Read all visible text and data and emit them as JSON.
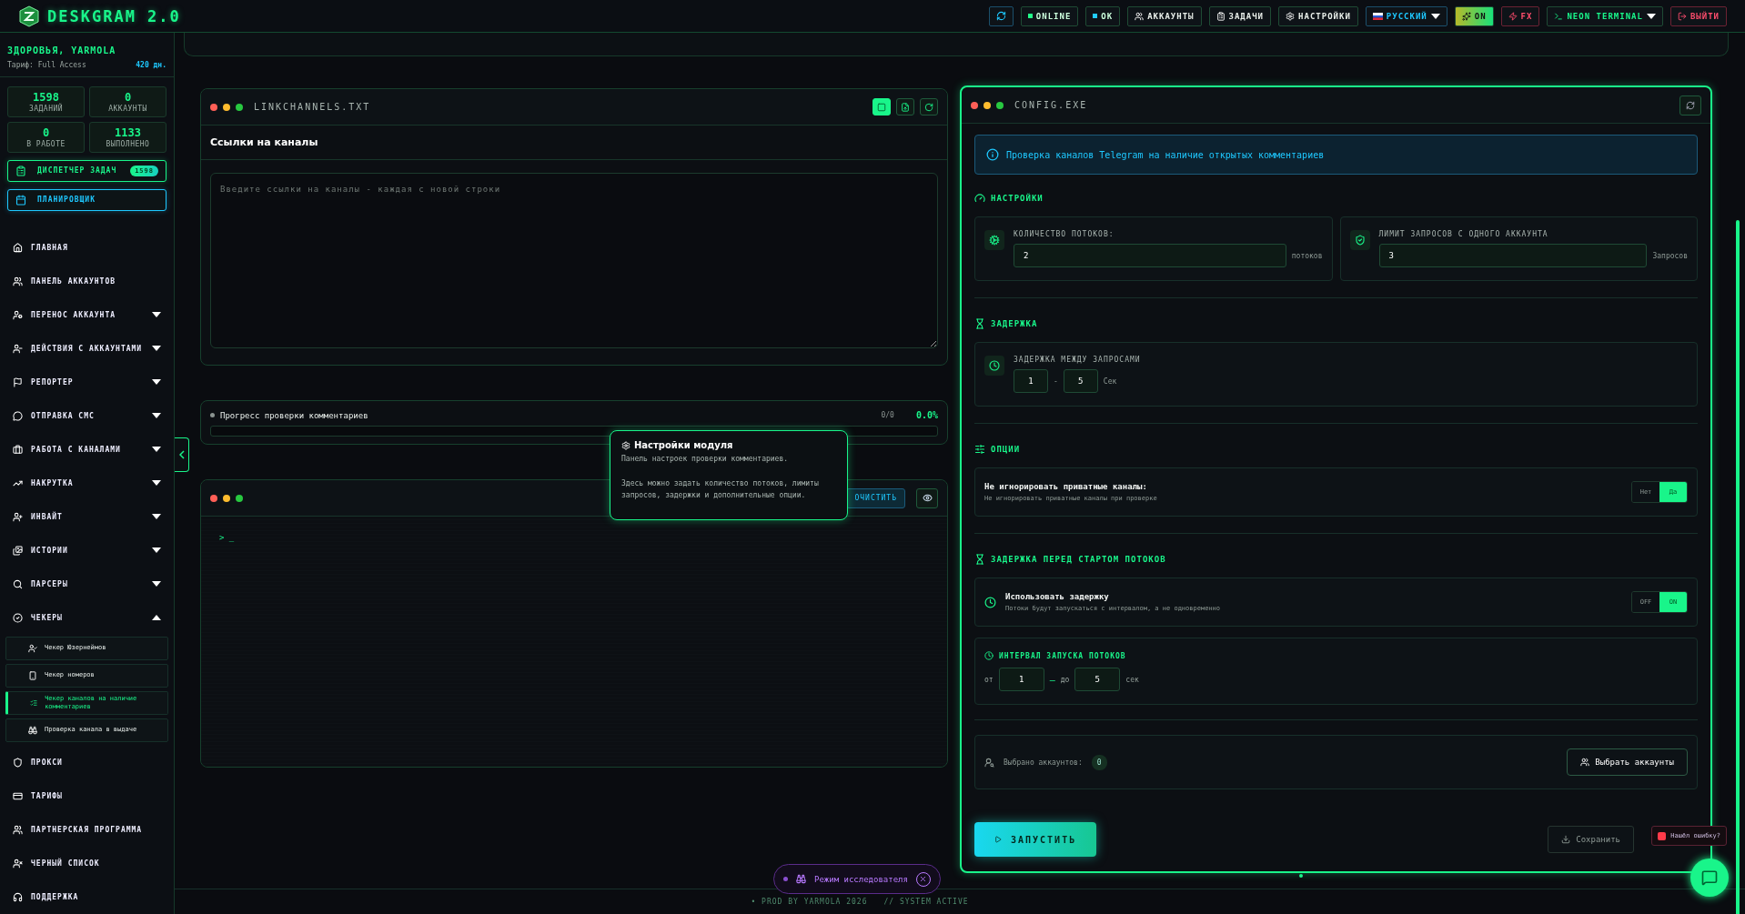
{
  "app": {
    "title": "DESKGRAM 2.0"
  },
  "header_buttons": [
    {
      "kind": "refresh"
    },
    {
      "kind": "status",
      "label": "ONLINE",
      "color": "#22ff88"
    },
    {
      "kind": "status",
      "label": "OK",
      "color": "#22ccff"
    },
    {
      "kind": "nav",
      "label": "АККАУНТЫ"
    },
    {
      "kind": "nav",
      "label": "ЗАДАЧИ"
    },
    {
      "kind": "nav",
      "label": "НАСТРОЙКИ"
    },
    {
      "kind": "language",
      "label": "РУССКИЙ"
    },
    {
      "kind": "toggle",
      "label": "ON",
      "on": true
    },
    {
      "kind": "fx",
      "label": "FX"
    },
    {
      "kind": "theme",
      "label": "NEON TERMINAL"
    },
    {
      "kind": "logout",
      "label": "ВЫЙТИ"
    }
  ],
  "sidebar": {
    "greeting": "ЗДОРОВЬЯ, YARMOLA",
    "tariff": "Тариф: Full Access",
    "days": "420 дн.",
    "stats": [
      {
        "value": "1598",
        "label": "ЗАДАНИЙ"
      },
      {
        "value": "0",
        "label": "АККАУНТЫ"
      },
      {
        "value": "0",
        "label": "В РАБОТЕ"
      },
      {
        "value": "1133",
        "label": "ВЫПОЛНЕНО"
      }
    ],
    "task_manager": {
      "label": "ДИСПЕТЧЕР ЗАДАЧ",
      "count": "1598"
    },
    "scheduler": {
      "label": "ПЛАНИРОВЩИК"
    },
    "items": [
      {
        "label": "ГЛАВНАЯ"
      },
      {
        "label": "ПАНЕЛЬ АККАУНТОВ"
      },
      {
        "label": "ПЕРЕНОС АККАУНТА",
        "expanded": false
      },
      {
        "label": "ДЕЙСТВИЯ С АККАУНТАМИ",
        "expanded": false
      },
      {
        "label": "РЕПОРТЕР",
        "expanded": false
      },
      {
        "label": "ОТПРАВКА СМС",
        "expanded": false
      },
      {
        "label": "РАБОТА С КАНАЛАМИ",
        "expanded": false
      },
      {
        "label": "НАКРУТКА",
        "expanded": false
      },
      {
        "label": "ИНВАЙТ",
        "expanded": false
      },
      {
        "label": "ИСТОРИИ",
        "expanded": false
      },
      {
        "label": "ПАРСЕРЫ",
        "expanded": false
      },
      {
        "label": "ЧЕКЕРЫ",
        "expanded": true,
        "children": [
          {
            "label": "Чекер Юзернеймов",
            "selected": false
          },
          {
            "label": "Чекер номеров",
            "selected": false
          },
          {
            "label": "Чекер каналов на наличие комментариев",
            "selected": true
          },
          {
            "label": "Проверка канала в выдаче",
            "selected": false
          }
        ]
      },
      {
        "label": "ПРОКСИ"
      },
      {
        "label": "ТАРИФЫ"
      },
      {
        "label": "ПАРТНЕРСКАЯ ПРОГРАММА"
      },
      {
        "label": "ЧЕРНЫЙ СПИСОК"
      },
      {
        "label": "ПОДДЕРЖКА"
      }
    ]
  },
  "file_panel": {
    "title": "LINKCHANNELS.TXT",
    "tools": [
      {
        "selected": true
      },
      {
        "selected": false
      },
      {
        "selected": false
      }
    ],
    "heading": "Ссылки на каналы",
    "placeholder": "Введите ссылки на каналы - каждая с новой строки"
  },
  "progress": {
    "label": "Прогресс проверки комментариев",
    "count": "0/0",
    "percent": "0.0%",
    "level": 0
  },
  "terminal": {
    "clear_label": "ОЧИСТИТЬ",
    "prompt": "> _"
  },
  "tooltip": {
    "title": "Настройки модуля",
    "lines": [
      "Панель настроек проверки комментариев.",
      "Здесь можно задать количество потоков, лимиты запросов, задержки и дополнительные опции."
    ]
  },
  "config": {
    "title": "CONFIG.EXE",
    "info": "Проверка каналов Telegram на наличие открытых комментариев",
    "settings_heading": "НАСТРОЙКИ",
    "fields": [
      {
        "label": "КОЛИЧЕСТВО ПОТОКОВ:",
        "value": "2",
        "unit": "потоков"
      },
      {
        "label": "ЛИМИТ ЗАПРОСОВ С ОДНОГО АККАУНТА",
        "value": "3",
        "unit": "Запросов"
      }
    ],
    "delay_heading": "ЗАДЕРЖКА",
    "delay": {
      "label": "ЗАДЕРЖКА МЕЖДУ ЗАПРОСАМИ",
      "from": "1",
      "separator": "-",
      "to": "5",
      "unit": "Сек"
    },
    "options_heading": "ОПЦИИ",
    "options": [
      {
        "title": "Не игнорировать приватные каналы:",
        "description": "Не игнорировать приватные каналы при проверке",
        "off_label": "Нет",
        "on_label": "Да",
        "on": true
      }
    ],
    "start_heading": "ЗАДЕРЖКА ПЕРЕД СТАРТОМ ПОТОКОВ",
    "start_delay": {
      "title": "Использовать задержку",
      "description": "Потоки будут запускаться с интервалом, а не одновременно",
      "off_label": "OFF",
      "on_label": "ON",
      "on": true
    },
    "interval": {
      "title": "ИНТЕРВАЛ ЗАПУСКА ПОТОКОВ",
      "from_label": "от",
      "from": "1",
      "dash": "—",
      "to_label": "до",
      "to": "5",
      "unit": "сек"
    },
    "accounts": {
      "label": "Выбрано аккаунтов:",
      "count": "0",
      "button": "Выбрать аккаунты"
    },
    "run": "ЗАПУСТИТЬ",
    "save": "Сохранить"
  },
  "explorer": {
    "label": "Режим исследователя"
  },
  "bug_report": {
    "label": "Нашёл ошибку?"
  },
  "footer": {
    "left": "• PROD BY YARMOLA 2026",
    "right": "// SYSTEM ACTIVE"
  }
}
